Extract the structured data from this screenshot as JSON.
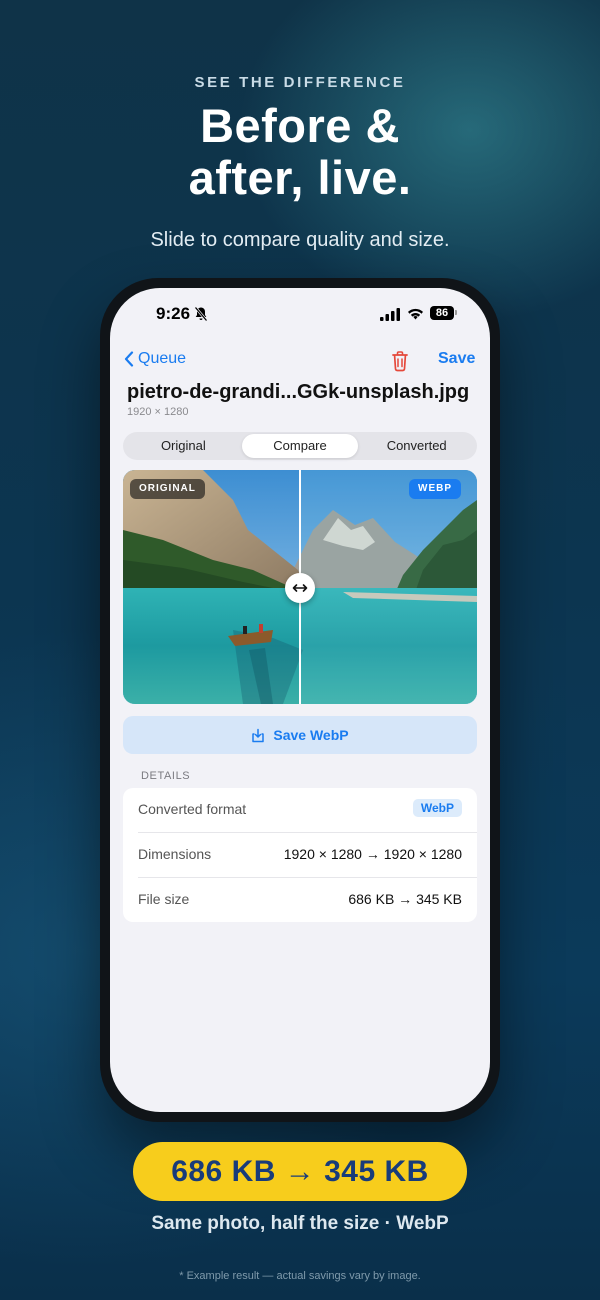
{
  "promo": {
    "kicker": "SEE THE DIFFERENCE",
    "headline": "Before &\nafter, live.",
    "subline": "Slide to compare quality and size.",
    "pill": "686 KB → 345 KB",
    "tagline": "Same photo, half the size · WebP",
    "footnote": "* Example result — actual savings vary by image."
  },
  "status_bar": {
    "time": "9:26",
    "battery": "86",
    "icons": [
      "bell-slash-icon",
      "signal-icon",
      "wifi-icon",
      "battery-icon"
    ]
  },
  "nav": {
    "back_label": "Queue",
    "save_label": "Save",
    "icons": [
      "chevron-left-icon",
      "trash-icon"
    ]
  },
  "file": {
    "name": "pietro-de-grandi...GGk-unsplash.jpg",
    "dimensions": "1920 × 1280"
  },
  "segments": {
    "items": [
      "Original",
      "Compare",
      "Converted"
    ],
    "selected": "Compare"
  },
  "compare": {
    "left_label": "ORIGINAL",
    "right_label": "WEBP",
    "slider_position": 0.5
  },
  "save_button": {
    "label": "Save WebP",
    "icon": "download-icon"
  },
  "details": {
    "header": "DETAILS",
    "rows": [
      {
        "label": "Converted format",
        "value": "WebP"
      },
      {
        "label": "Dimensions",
        "value": "1920 × 1280 → 1920 × 1280"
      },
      {
        "label": "File size",
        "value": "686 KB → 345 KB"
      }
    ]
  },
  "colors": {
    "accent": "#1a7cf0",
    "pill": "#f7cd1c",
    "pill_text": "#183c7a",
    "background": "#0c3550",
    "trash": "#e5483a"
  }
}
